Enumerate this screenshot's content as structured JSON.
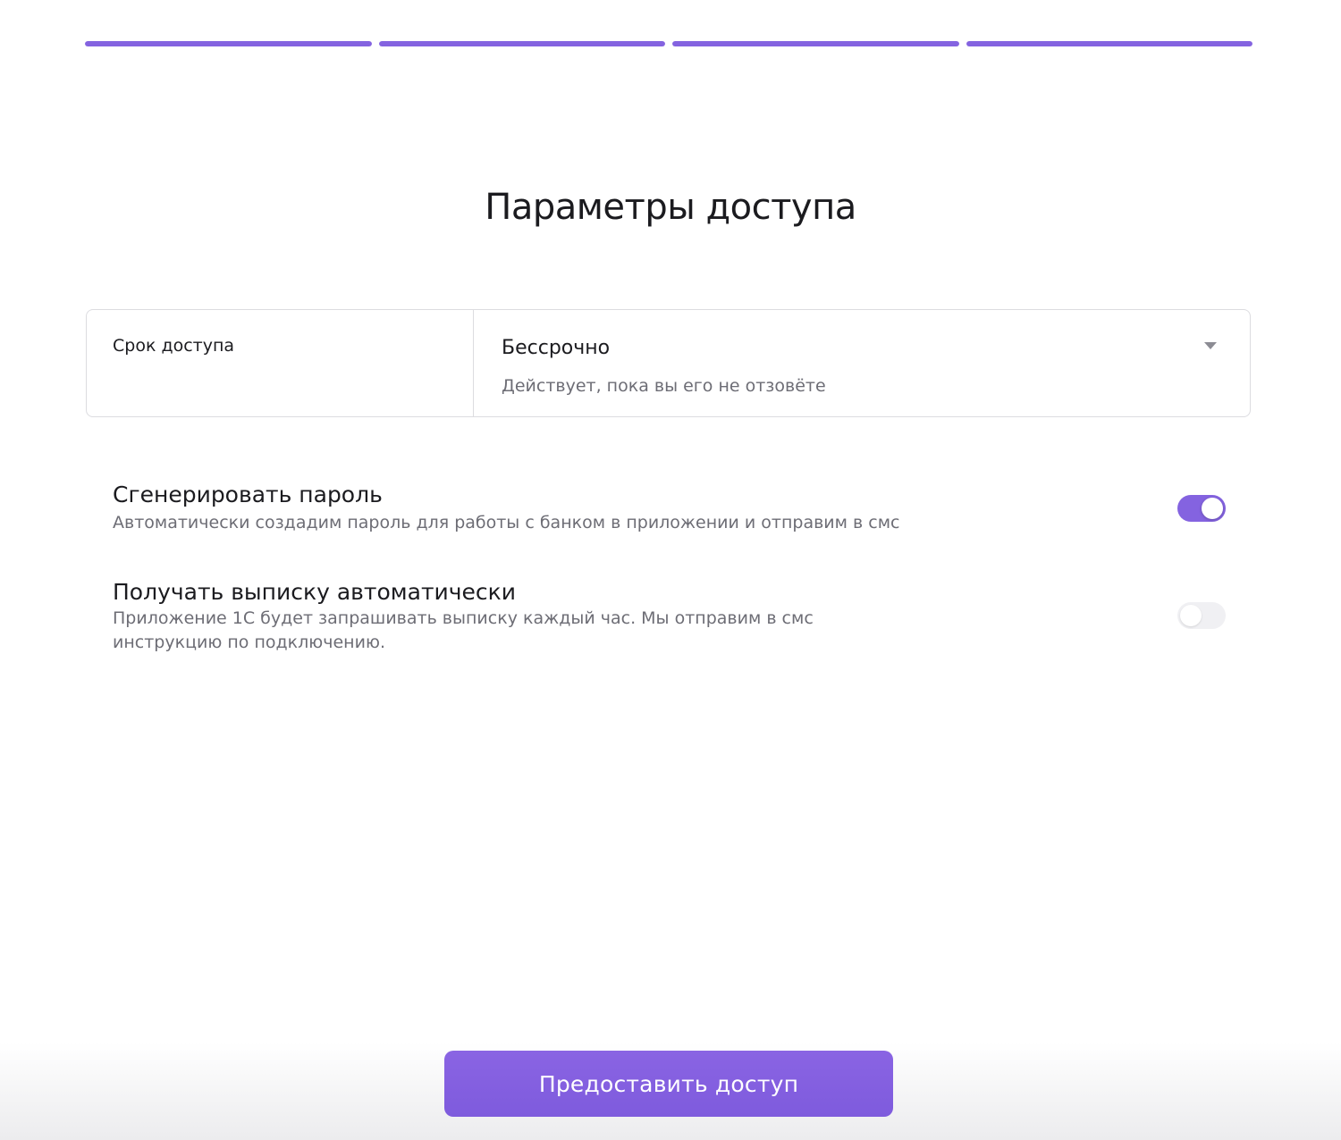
{
  "progress": {
    "steps": [
      {
        "value": 1
      },
      {
        "value": 1
      },
      {
        "value": 1
      },
      {
        "value": 1
      }
    ],
    "color": "#8463e0"
  },
  "page_title": "Параметры доступа",
  "access_term": {
    "label": "Срок доступа",
    "selected_value": "Бессрочно",
    "hint": "Действует, пока вы его не отзовёте"
  },
  "options": {
    "generate_password": {
      "title": "Сгенерировать пароль",
      "description": "Автоматически создадим пароль для работы с банком в приложении и отправим в смс",
      "enabled": true
    },
    "auto_statement": {
      "title": "Получать выписку автоматически",
      "description": "Приложение 1С будет запрашивать выписку каждый час. Мы отправим в смс инструкцию по подключению.",
      "enabled": false
    }
  },
  "submit_button": {
    "label": "Предоставить доступ"
  },
  "colors": {
    "accent": "#8463e0",
    "text_primary": "#1b1b1f",
    "text_secondary": "#6d6d75",
    "border": "#dcdce0"
  }
}
